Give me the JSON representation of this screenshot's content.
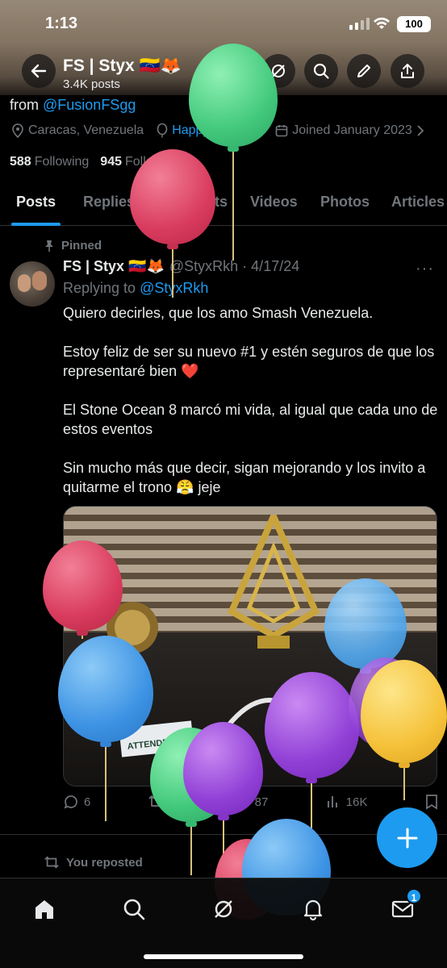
{
  "status_bar": {
    "time": "1:13",
    "battery": "100"
  },
  "header": {
    "name": "FS | Styx 🇻🇪🦊",
    "posts_count": "3.4K posts"
  },
  "profile": {
    "from_prefix": "from ",
    "from_link": "@FusionFSgg",
    "location": "Caracas, Venezuela",
    "birthday": "Happy birthday!",
    "joined": "Joined January 2023",
    "following_count": "588",
    "following_label": "Following",
    "followers_count": "945",
    "followers_label": "Followers"
  },
  "tabs": [
    "Posts",
    "Replies",
    "Highlights",
    "Videos",
    "Photos",
    "Articles"
  ],
  "post": {
    "pinned_label": "Pinned",
    "author": "FS | Styx 🇻🇪🦊",
    "handle_date": "@StyxRkh · 4/17/24",
    "more": "···",
    "replying_prefix": "Replying to ",
    "replying_handle": "@StyxRkh",
    "paragraphs": [
      "Quiero decirles, que los amo Smash Venezuela.",
      "Estoy feliz de ser su nuevo #1 y estén seguros de que los representaré bien ❤️",
      "El Stone Ocean 8 marcó mi vida, al igual que cada uno de estos eventos",
      "Sin mucho más que decir, sigan mejorando y los invito a quitarme el trono 😤 jeje"
    ],
    "media_card_text": "ATTENDEE",
    "replies": "6",
    "reposts": "9",
    "likes": "87",
    "views": "16K"
  },
  "next_post": {
    "reposted_label": "You reposted"
  },
  "bottom_nav": {
    "messages_badge": "1"
  },
  "colors": {
    "accent": "#1d9bf0",
    "background": "#000000",
    "muted": "#71767b"
  }
}
